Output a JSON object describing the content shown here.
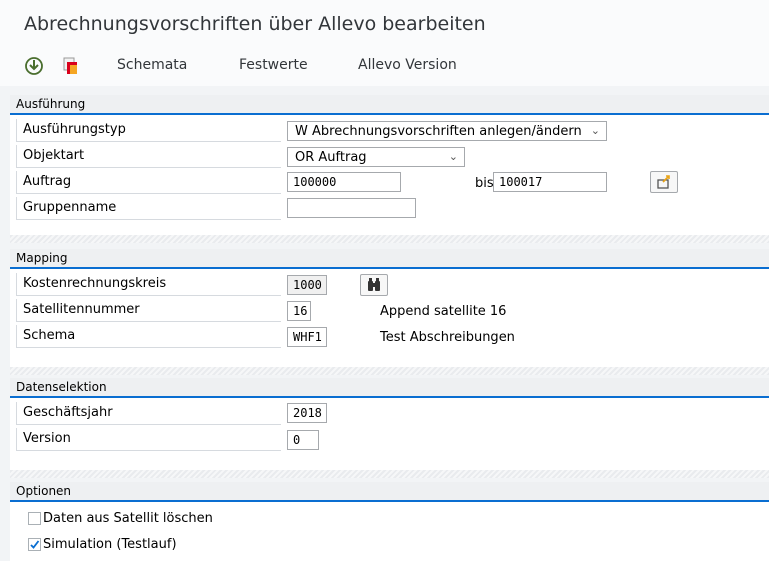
{
  "title": "Abrechnungsvorschriften über Allevo bearbeiten",
  "toolbar": {
    "items": [
      "Schemata",
      "Festwerte",
      "Allevo Version"
    ]
  },
  "sections": {
    "execution": {
      "title": "Ausführung",
      "type_label": "Ausführungstyp",
      "type_value": "W Abrechnungsvorschriften anlegen/ändern",
      "objtype_label": "Objektart",
      "objtype_value": "OR Auftrag",
      "order_label": "Auftrag",
      "order_from": "100000",
      "bis_label": "bis",
      "order_to": "100017",
      "group_label": "Gruppenname",
      "group_value": ""
    },
    "mapping": {
      "title": "Mapping",
      "cca_label": "Kostenrechnungskreis",
      "cca_value": "1000",
      "satellite_label": "Satellitennummer",
      "satellite_value": "16",
      "satellite_desc": "Append satellite 16",
      "schema_label": "Schema",
      "schema_value": "WHF1",
      "schema_desc": "Test Abschreibungen"
    },
    "selection": {
      "title": "Datenselektion",
      "year_label": "Geschäftsjahr",
      "year_value": "2018",
      "version_label": "Version",
      "version_value": "0"
    },
    "options": {
      "title": "Optionen",
      "delete_label": "Daten aus Satellit löschen",
      "delete_checked": false,
      "simulation_label": "Simulation (Testlauf)",
      "simulation_checked": true
    }
  },
  "colors": {
    "accent": "#0a6ed1",
    "checkmark": "#0a6ed1"
  }
}
